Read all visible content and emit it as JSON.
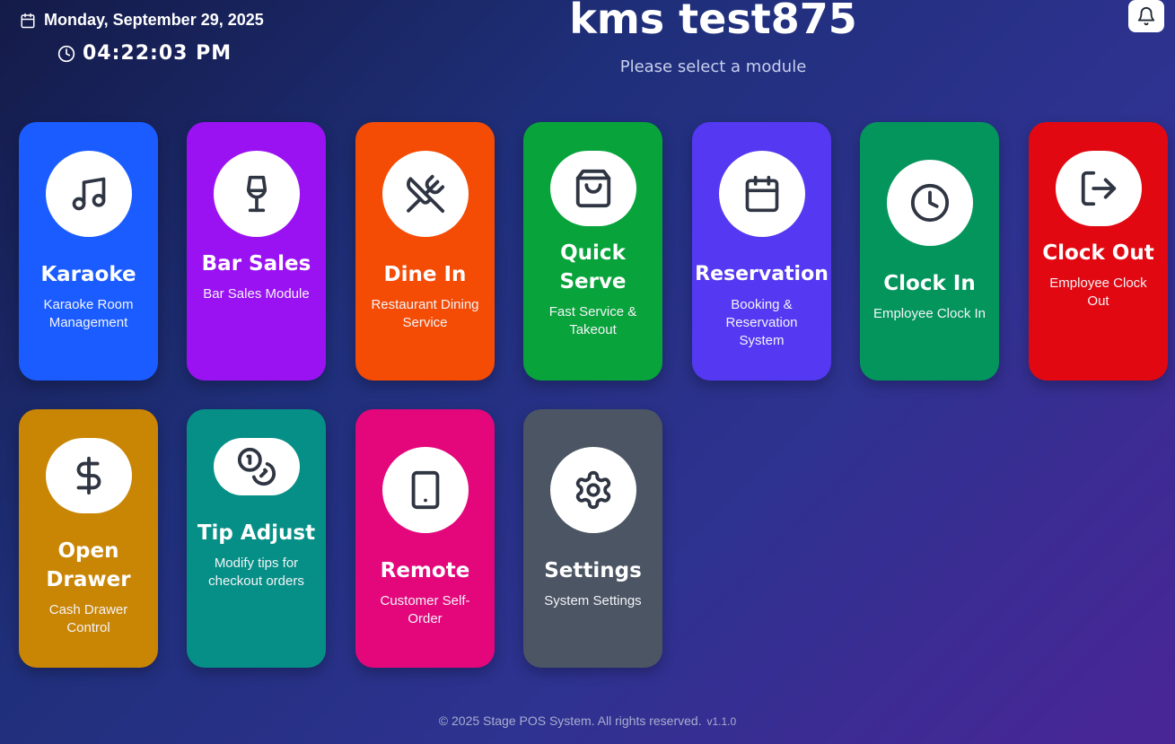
{
  "header": {
    "date": "Monday, September 29, 2025",
    "time": "04:22:03 PM",
    "title": "kms test875",
    "subtitle": "Please select a module",
    "icons": {
      "date": "calendar-icon",
      "time": "clock-icon",
      "notifications": "bell-icon"
    }
  },
  "modules": [
    {
      "name": "Karaoke",
      "desc": "Karaoke Room Management",
      "color": "#1a5cff",
      "icon": "music-note-icon"
    },
    {
      "name": "Bar Sales",
      "desc": "Bar Sales Module",
      "color": "#9a12f2",
      "icon": "wine-glass-icon"
    },
    {
      "name": "Dine In",
      "desc": "Restaurant Dining Service",
      "color": "#f44b05",
      "icon": "utensils-crossed-icon"
    },
    {
      "name": "Quick Serve",
      "desc": "Fast Service & Takeout",
      "color": "#08a33b",
      "icon": "shopping-bag-icon"
    },
    {
      "name": "Reservation",
      "desc": "Booking & Reservation System",
      "color": "#5538f2",
      "icon": "calendar-icon"
    },
    {
      "name": "Clock In",
      "desc": "Employee Clock In",
      "color": "#03955c",
      "icon": "clock-icon"
    },
    {
      "name": "Clock Out",
      "desc": "Employee Clock Out",
      "color": "#e10812",
      "icon": "log-out-icon"
    },
    {
      "name": "Open Drawer",
      "desc": "Cash Drawer Control",
      "color": "#c98504",
      "icon": "dollar-sign-icon"
    },
    {
      "name": "Tip Adjust",
      "desc": "Modify tips for checkout orders",
      "color": "#068f86",
      "icon": "coins-icon"
    },
    {
      "name": "Remote",
      "desc": "Customer Self-Order",
      "color": "#e3077b",
      "icon": "tablet-icon"
    },
    {
      "name": "Settings",
      "desc": "System Settings",
      "color": "#4b5563",
      "icon": "gear-icon"
    }
  ],
  "footer": {
    "text": "© 2025 Stage POS System. All rights reserved.",
    "version": "v1.1.0"
  }
}
